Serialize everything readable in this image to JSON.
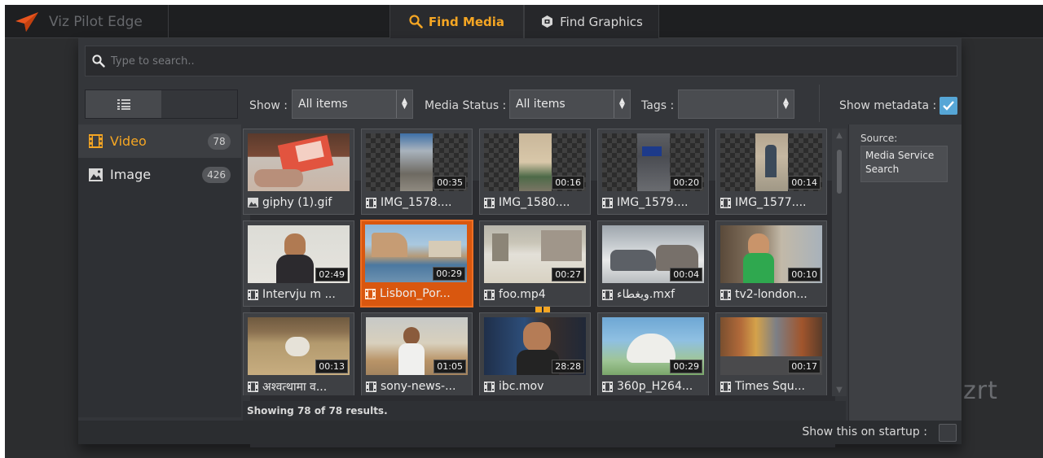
{
  "app": {
    "title": "Viz Pilot Edge",
    "logo_icon": "paper-plane-icon"
  },
  "tabs": [
    {
      "label": "Find Media",
      "icon": "search-icon",
      "active": true
    },
    {
      "label": "Find Graphics",
      "icon": "graphics-icon",
      "active": false
    }
  ],
  "search": {
    "placeholder": "Type to search..",
    "value": ""
  },
  "toolbar": {
    "view_modes": [
      {
        "icon": "list-view-icon"
      },
      {
        "icon": "grid-view-icon",
        "active": true
      }
    ],
    "show_label": "Show :",
    "show_value": "All items",
    "media_status_label": "Media Status :",
    "media_status_value": "All items",
    "tags_label": "Tags :",
    "tags_value": "",
    "show_metadata_label": "Show metadata :",
    "show_metadata_checked": true
  },
  "sidebar": {
    "items": [
      {
        "label": "Video",
        "count": "78",
        "icon": "film-icon",
        "active": true
      },
      {
        "label": "Image",
        "count": "426",
        "icon": "image-icon",
        "active": false
      }
    ]
  },
  "media": [
    {
      "name": "giphy (1).gif",
      "type": "image",
      "duration": ""
    },
    {
      "name": "IMG_1578....",
      "type": "video",
      "duration": "00:35"
    },
    {
      "name": "IMG_1580....",
      "type": "video",
      "duration": "00:16"
    },
    {
      "name": "IMG_1579....",
      "type": "video",
      "duration": "00:20"
    },
    {
      "name": "IMG_1577....",
      "type": "video",
      "duration": "00:14"
    },
    {
      "name": "Intervju m ...",
      "type": "video",
      "duration": "02:49"
    },
    {
      "name": "Lisbon_Por...",
      "type": "video",
      "duration": "00:29",
      "selected": true
    },
    {
      "name": "foo.mp4",
      "type": "video",
      "duration": "00:27"
    },
    {
      "name": "ويغطاء.mxf",
      "type": "video",
      "duration": "00:04"
    },
    {
      "name": "tv2-london...",
      "type": "video",
      "duration": "00:10"
    },
    {
      "name": "अश्वत्थामा व...",
      "type": "video",
      "duration": "00:13"
    },
    {
      "name": "sony-news-...",
      "type": "video",
      "duration": "01:05"
    },
    {
      "name": "ibc.mov",
      "type": "video",
      "duration": "28:28"
    },
    {
      "name": "360p_H264...",
      "type": "video",
      "duration": "00:29"
    },
    {
      "name": "Times Squ...",
      "type": "video",
      "duration": "00:17"
    }
  ],
  "results_text": "Showing 78 of 78 results.",
  "metadata": {
    "source_label": "Source:",
    "source_value": "Media Service Search"
  },
  "footer": {
    "startup_label": "Show this on startup :",
    "startup_checked": false
  },
  "watermark": "zrt",
  "colors": {
    "accent": "#f5a623",
    "selected": "#d9570f",
    "checkbox": "#56a6d6"
  }
}
